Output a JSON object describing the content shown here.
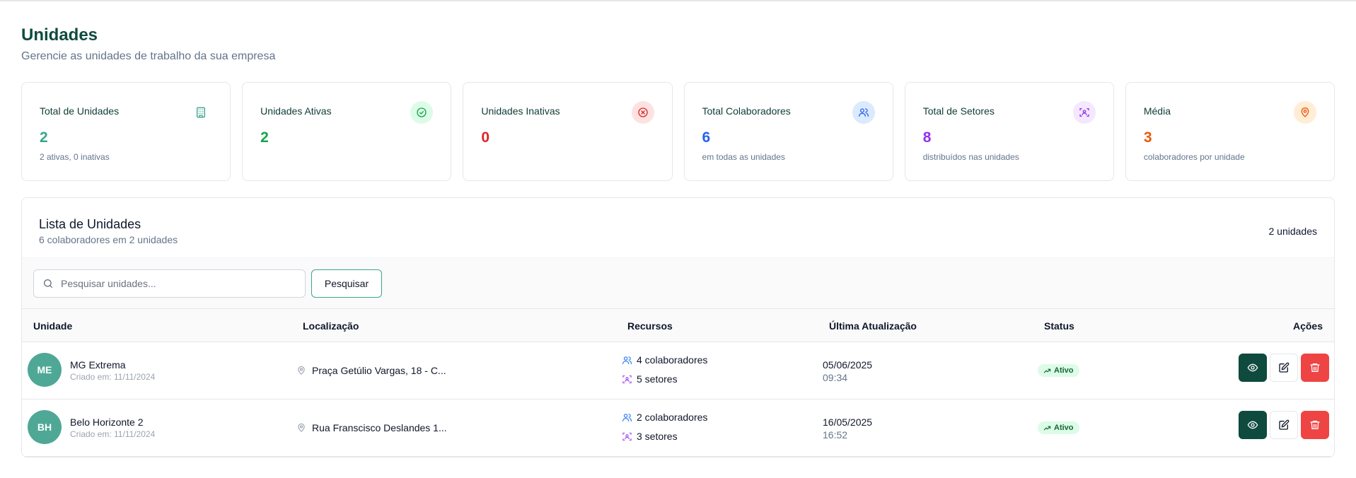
{
  "header": {
    "title": "Unidades",
    "subtitle": "Gerencie as unidades de trabalho da sua empresa"
  },
  "stats": [
    {
      "label": "Total de Unidades",
      "value": "2",
      "note": "2 ativas, 0 inativas",
      "icon": "building-icon",
      "color": "#3aa58c",
      "icon_bg": "#ffffff"
    },
    {
      "label": "Unidades Ativas",
      "value": "2",
      "note": "",
      "icon": "check-circle-icon",
      "color": "#16a34a",
      "icon_bg": "#dcfce7"
    },
    {
      "label": "Unidades Inativas",
      "value": "0",
      "note": "",
      "icon": "x-circle-icon",
      "color": "#dc2626",
      "icon_bg": "#fee2e2"
    },
    {
      "label": "Total Colaboradores",
      "value": "6",
      "note": "em todas as unidades",
      "icon": "users-icon",
      "color": "#2563eb",
      "icon_bg": "#dbeafe"
    },
    {
      "label": "Total de Setores",
      "value": "8",
      "note": "distribuídos nas unidades",
      "icon": "sectors-icon",
      "color": "#9333ea",
      "icon_bg": "#f3e8ff"
    },
    {
      "label": "Média",
      "value": "3",
      "note": "colaboradores por unidade",
      "icon": "map-pin-icon",
      "color": "#ea580c",
      "icon_bg": "#ffedd5"
    }
  ],
  "list": {
    "title": "Lista de Unidades",
    "subtitle": "6 colaboradores em 2 unidades",
    "count": "2 unidades",
    "search_placeholder": "Pesquisar unidades...",
    "search_value": "",
    "search_button": "Pesquisar",
    "columns": [
      "Unidade",
      "Localização",
      "Recursos",
      "Última Atualização",
      "Status",
      "Ações"
    ],
    "rows": [
      {
        "initials": "ME",
        "name": "MG Extrema",
        "created": "Criado em: 11/11/2024",
        "location": "Praça Getúlio Vargas, 18 - C...",
        "collaborators": "4 colaboradores",
        "sectors": "5 setores",
        "date": "05/06/2025",
        "time": "09:34",
        "status": "Ativo"
      },
      {
        "initials": "BH",
        "name": "Belo Horizonte 2",
        "created": "Criado em: 11/11/2024",
        "location": "Rua Franscisco Deslandes 1...",
        "collaborators": "2 colaboradores",
        "sectors": "3 setores",
        "date": "16/05/2025",
        "time": "16:52",
        "status": "Ativo"
      }
    ]
  },
  "colors": {
    "brand_dark": "#0f4a3f",
    "avatar": "#4fa896",
    "delete": "#ef4444"
  }
}
